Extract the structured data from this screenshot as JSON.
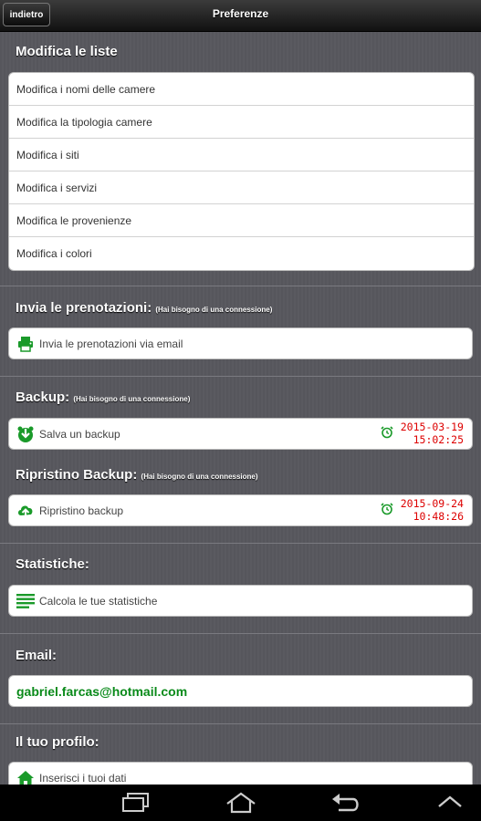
{
  "header": {
    "back_label": "indietro",
    "title": "Preferenze"
  },
  "lists": {
    "title": "Modifica le liste",
    "items": [
      "Modifica i nomi delle camere",
      "Modifica la tipologia camere",
      "Modifica i siti",
      "Modifica i servizi",
      "Modifica le provenienze",
      "Modifica i colori"
    ]
  },
  "send": {
    "title": "Invia le prenotazioni:",
    "note": "(Hai bisogno di una connessione)",
    "action": "Invia le prenotazioni via email",
    "icon": "printer-icon"
  },
  "backup": {
    "title": "Backup:",
    "note": "(Hai bisogno di una connessione)",
    "action": "Salva un backup",
    "date": "2015-03-19",
    "time": "15:02:25",
    "icon": "backup-icon"
  },
  "restore": {
    "title": "Ripristino Backup:",
    "note": "(Hai bisogno di una connessione)",
    "action": "Ripristino backup",
    "date": "2015-09-24",
    "time": "10:48:26",
    "icon": "cloud-upload-icon"
  },
  "stats": {
    "title": "Statistiche:",
    "action": "Calcola le tue statistiche",
    "icon": "lines-icon"
  },
  "email": {
    "title": "Email:",
    "value": "gabriel.farcas@hotmail.com"
  },
  "profile": {
    "title": "Il tuo profilo:",
    "action": "Inserisci i tuoi dati",
    "icon": "home-icon"
  },
  "colors": {
    "accent_green": "#1a9a2a",
    "timestamp_red": "#dd0000"
  }
}
